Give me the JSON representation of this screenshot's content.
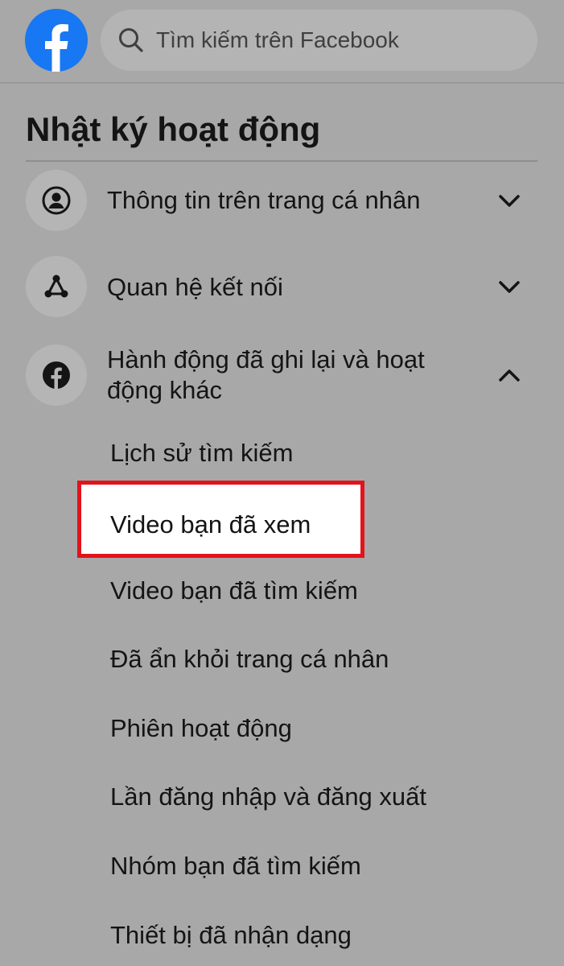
{
  "header": {
    "logo_icon": "facebook-logo-icon",
    "search": {
      "icon": "search-icon",
      "placeholder": "Tìm kiếm trên Facebook"
    }
  },
  "page": {
    "title": "Nhật ký hoạt động"
  },
  "sections": [
    {
      "label": "Thông tin trên trang cá nhân",
      "icon": "profile-icon",
      "state": "collapsed"
    },
    {
      "label": "Quan hệ kết nối",
      "icon": "connections-icon",
      "state": "collapsed"
    },
    {
      "label": "Hành động đã ghi lại và hoạt động khác",
      "icon": "facebook-icon",
      "state": "expanded"
    }
  ],
  "sub_items": [
    {
      "label": "Lịch sử tìm kiếm"
    },
    {
      "label": "Video bạn đã xem",
      "highlighted": true
    },
    {
      "label": "Video bạn đã tìm kiếm"
    },
    {
      "label": "Đã ẩn khỏi trang cá nhân"
    },
    {
      "label": "Phiên hoạt động"
    },
    {
      "label": "Lần đăng nhập và đăng xuất"
    },
    {
      "label": "Nhóm bạn đã tìm kiếm"
    },
    {
      "label": "Thiết bị đã nhận dạng"
    }
  ],
  "colors": {
    "facebook_blue": "#1877f2",
    "highlight_border": "#e3131b",
    "overlay_background": "#a8a8a8"
  }
}
